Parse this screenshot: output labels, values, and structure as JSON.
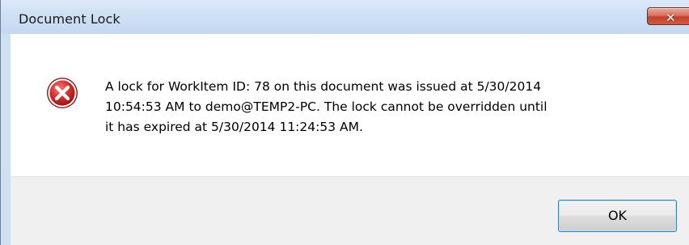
{
  "dialog": {
    "title": "Document Lock",
    "close_icon": "close-icon",
    "error_icon": "error-icon",
    "message": "A lock for WorkItem ID: 78 on this document was issued at 5/30/2014\n10:54:53 AM to demo@TEMP2-PC.  The lock cannot be overridden until\nit has expired at 5/30/2014 11:24:53 AM.",
    "ok_label": "OK"
  },
  "colors": {
    "titlebar": "#cfe0f3",
    "close_button": "#c4412c",
    "footer": "#f0f0f0",
    "ok_button_border": "#3c7fb1",
    "error_red": "#c8262b"
  }
}
